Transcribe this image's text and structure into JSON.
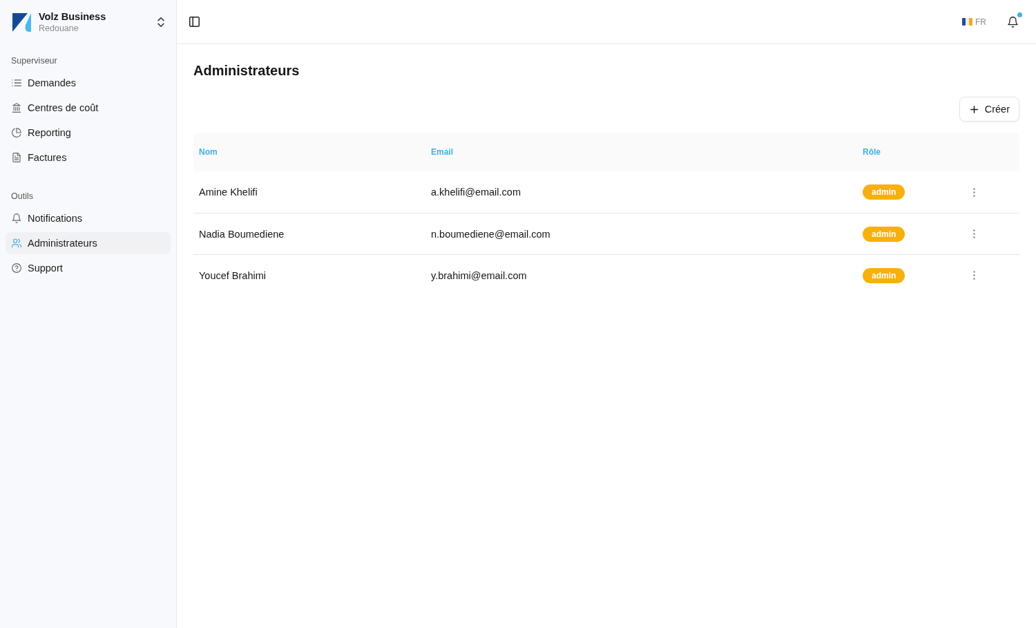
{
  "workspace": {
    "name": "Volz Business",
    "user": "Redouane"
  },
  "sidebar": {
    "sections": [
      {
        "label": "Superviseur",
        "items": [
          {
            "label": "Demandes",
            "selected": false
          },
          {
            "label": "Centres de coût",
            "selected": false
          },
          {
            "label": "Reporting",
            "selected": false
          },
          {
            "label": "Factures",
            "selected": false
          }
        ]
      },
      {
        "label": "Outils",
        "items": [
          {
            "label": "Notifications",
            "selected": false
          },
          {
            "label": "Administrateurs",
            "selected": true
          },
          {
            "label": "Support",
            "selected": false
          }
        ]
      }
    ]
  },
  "topbar": {
    "language": "FR",
    "notifications": {
      "unread": true
    }
  },
  "page": {
    "title": "Administrateurs",
    "create_button": "Créer"
  },
  "table": {
    "columns": [
      "Nom",
      "Email",
      "Rôle"
    ],
    "rows": [
      {
        "name": "Amine Khelifi",
        "email": "a.khelifi@email.com",
        "role": "admin"
      },
      {
        "name": "Nadia Boumediene",
        "email": "n.boumediene@email.com",
        "role": "admin"
      },
      {
        "name": "Youcef Brahimi",
        "email": "y.brahimi@email.com",
        "role": "admin"
      }
    ]
  }
}
